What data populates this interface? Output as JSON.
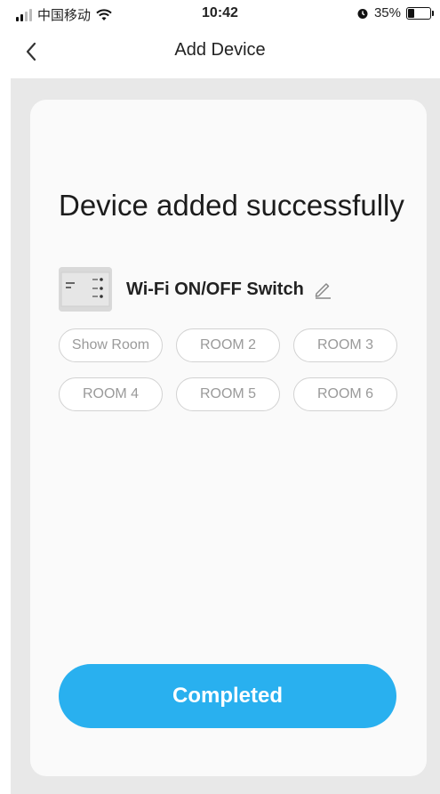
{
  "status_bar": {
    "carrier": "中国移动",
    "time": "10:42",
    "battery_percent": "35%",
    "battery_level": 0.35
  },
  "nav": {
    "title": "Add Device",
    "back_icon": "chevron-left-icon"
  },
  "card": {
    "title": "Device added successfully",
    "device_name": "Wi-Fi ON/OFF Switch",
    "edit_icon": "pencil-icon",
    "rooms": [
      "Show Room",
      "ROOM 2",
      "ROOM 3",
      "ROOM 4",
      "ROOM 5",
      "ROOM 6"
    ],
    "completed_label": "Completed"
  },
  "colors": {
    "accent": "#29b0ef",
    "content_bg": "#e8e8e8",
    "chip_text": "#9a9a9a"
  }
}
